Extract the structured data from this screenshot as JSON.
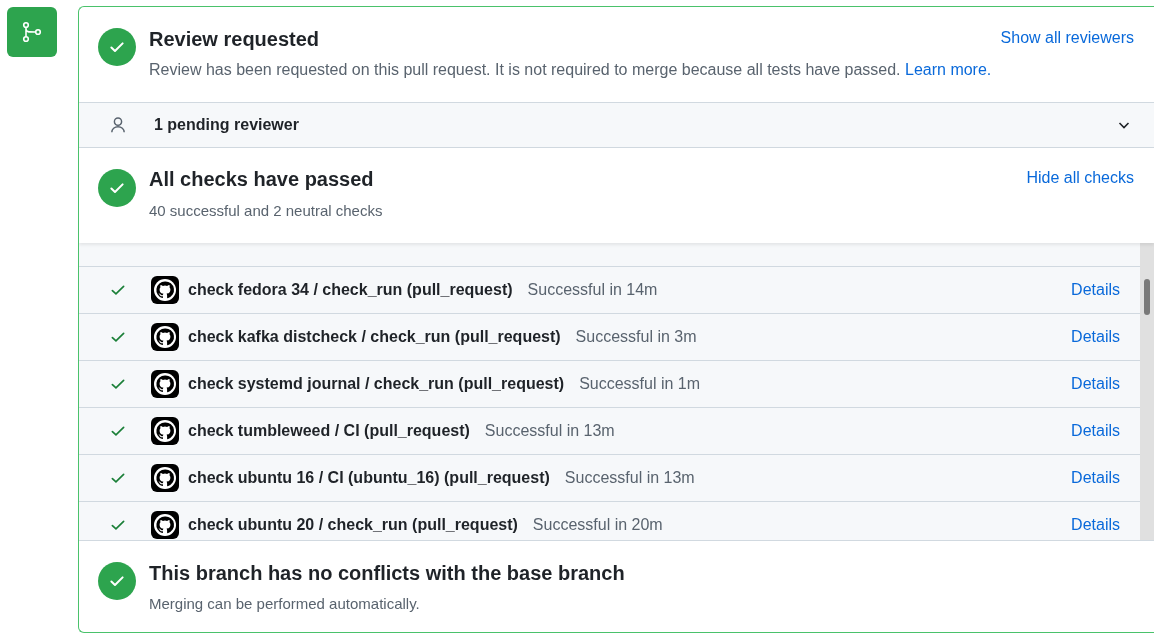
{
  "review": {
    "title": "Review requested",
    "description": "Review has been requested on this pull request. It is not required to merge because all tests have passed.",
    "learn_more": "Learn more.",
    "action": "Show all reviewers"
  },
  "pending": {
    "label": "1 pending reviewer",
    "expanded": false
  },
  "checks": {
    "title": "All checks have passed",
    "summary": "40 successful and 2 neutral checks",
    "action": "Hide all checks",
    "rows": [
      {
        "name": "check fedora 34 / check_run (pull_request)",
        "status": "Successful in 14m",
        "link": "Details"
      },
      {
        "name": "check kafka distcheck / check_run (pull_request)",
        "status": "Successful in 3m",
        "link": "Details"
      },
      {
        "name": "check systemd journal / check_run (pull_request)",
        "status": "Successful in 1m",
        "link": "Details"
      },
      {
        "name": "check tumbleweed / CI (pull_request)",
        "status": "Successful in 13m",
        "link": "Details"
      },
      {
        "name": "check ubuntu 16 / CI (ubuntu_16) (pull_request)",
        "status": "Successful in 13m",
        "link": "Details"
      },
      {
        "name": "check ubuntu 20 / check_run (pull_request)",
        "status": "Successful in 20m",
        "link": "Details"
      }
    ]
  },
  "merge": {
    "title": "This branch has no conflicts with the base branch",
    "description": "Merging can be performed automatically."
  }
}
